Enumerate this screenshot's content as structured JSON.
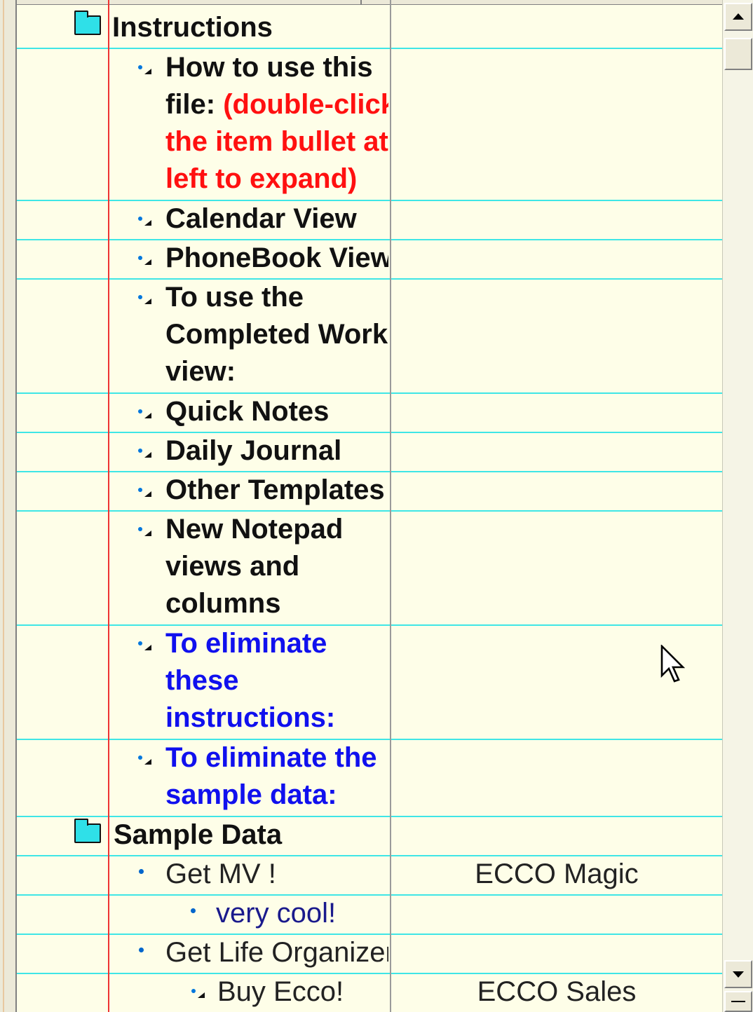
{
  "rows": [
    {
      "type": "folder",
      "label": "Instructions"
    },
    {
      "type": "item",
      "lines": [
        "How to use this",
        "file: "
      ],
      "red_continuation": "(double-click",
      "red_lines": [
        "the item bullet at",
        "left to expand)"
      ]
    },
    {
      "type": "item",
      "text": "Calendar View"
    },
    {
      "type": "item",
      "text": "PhoneBook View"
    },
    {
      "type": "item",
      "lines": [
        "To use the",
        "Completed Work",
        "view:"
      ]
    },
    {
      "type": "item",
      "text": "Quick Notes"
    },
    {
      "type": "item",
      "text": "Daily Journal"
    },
    {
      "type": "item",
      "text": "Other Templates"
    },
    {
      "type": "item",
      "lines": [
        "New Notepad",
        "views and",
        "columns"
      ]
    },
    {
      "type": "item",
      "lines": [
        "To eliminate",
        "these",
        "instructions:"
      ],
      "color": "blue"
    },
    {
      "type": "item",
      "lines": [
        "To eliminate the",
        "sample data:"
      ],
      "color": "blue"
    },
    {
      "type": "folder",
      "label": "Sample Data"
    },
    {
      "type": "item",
      "text": "Get MV !",
      "col2": "ECCO Magic"
    },
    {
      "type": "subitem",
      "text": "very cool!"
    },
    {
      "type": "item",
      "text": "Get Life Organizer"
    },
    {
      "type": "subitem",
      "text": "Buy Ecco!",
      "col2": "ECCO Sales"
    }
  ],
  "icons": {
    "folder": "folder-icon",
    "expand_bullet": "expand-bullet-icon",
    "dot_bullet": "dot-bullet-icon",
    "scroll_up": "scroll-up-arrow-icon",
    "scroll_down": "scroll-down-arrow-icon",
    "cursor": "mouse-pointer-icon"
  },
  "colors": {
    "background": "#fefee8",
    "row_line": "#3fe6e6",
    "margin_line": "#e33333",
    "folder": "#2fe0e8",
    "instruction_red": "#ff1010",
    "instruction_blue": "#1010ee"
  }
}
